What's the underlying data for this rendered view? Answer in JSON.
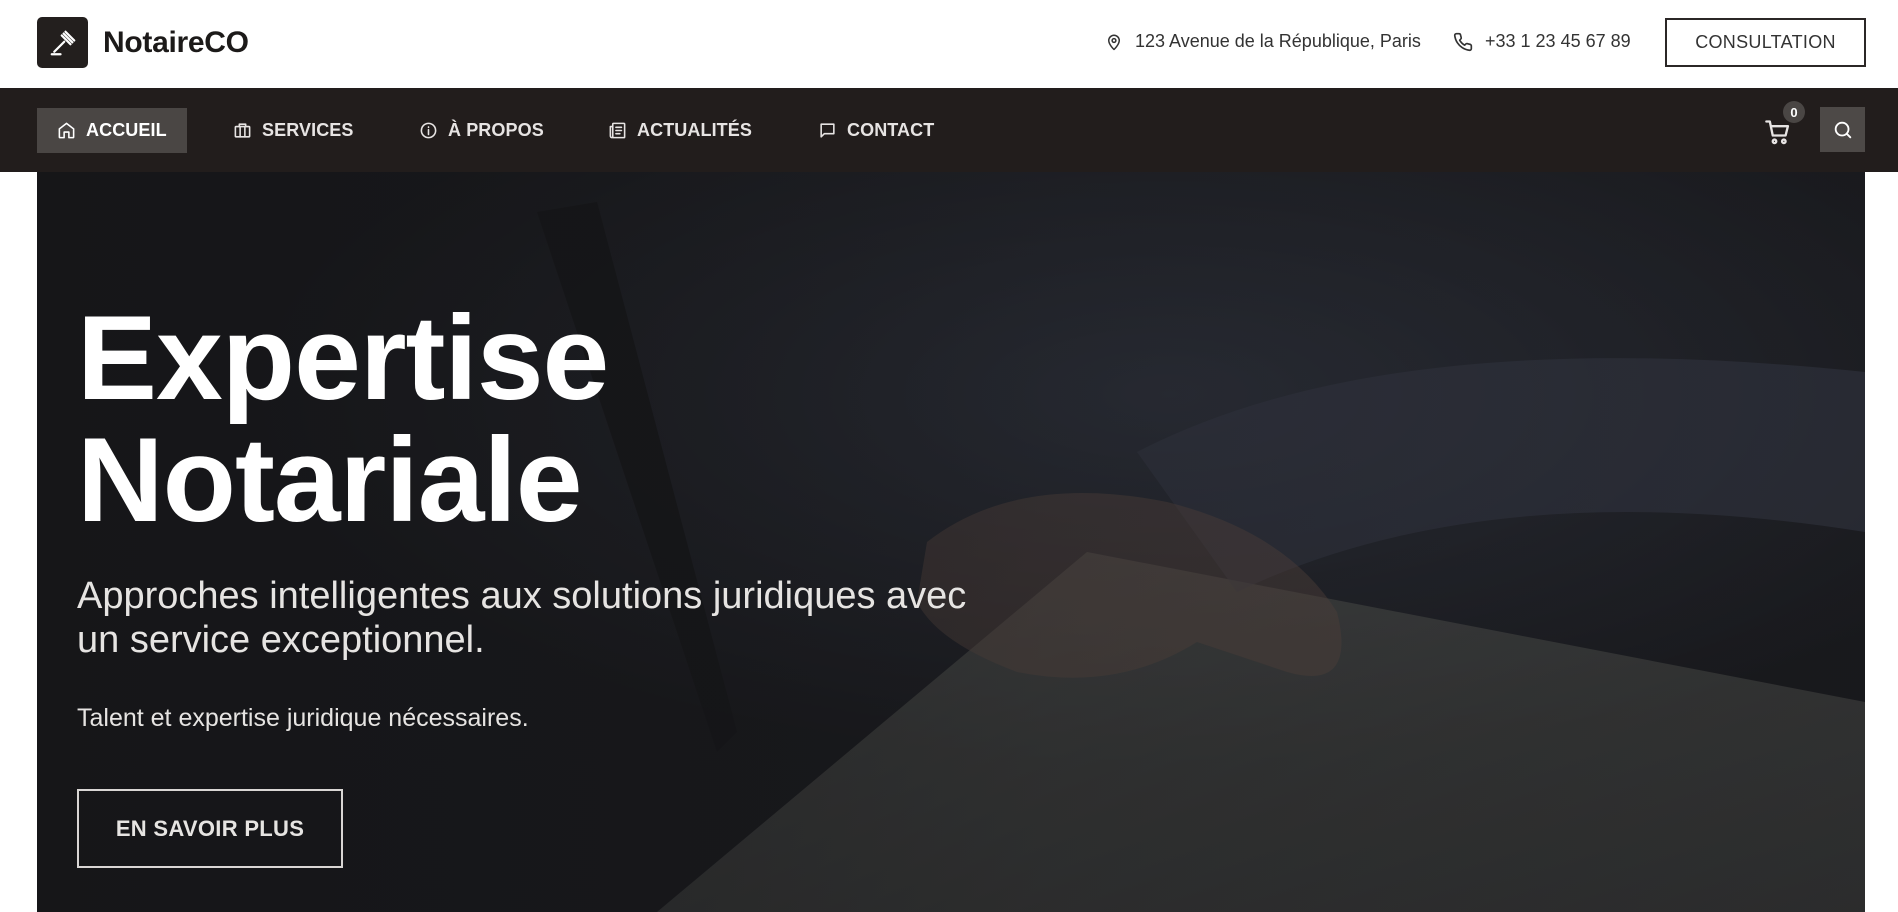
{
  "brand": {
    "name": "NotaireCO",
    "logo_icon": "gavel-icon"
  },
  "topbar": {
    "address": "123 Avenue de la République, Paris",
    "phone": "+33 1 23 45 67 89",
    "consult_label": "CONSULTATION"
  },
  "nav": {
    "items": [
      {
        "label": "ACCUEIL",
        "icon": "home-icon",
        "active": true
      },
      {
        "label": "SERVICES",
        "icon": "briefcase-icon",
        "active": false
      },
      {
        "label": "À PROPOS",
        "icon": "info-icon",
        "active": false
      },
      {
        "label": "ACTUALITÉS",
        "icon": "newspaper-icon",
        "active": false
      },
      {
        "label": "CONTACT",
        "icon": "chat-icon",
        "active": false
      }
    ],
    "cart_count": "0"
  },
  "hero": {
    "title_line1": "Expertise",
    "title_line2": "Notariale",
    "subtitle": "Approches intelligentes aux solutions juridiques avec un service exceptionnel.",
    "tagline": "Talent et expertise juridique nécessaires.",
    "cta_label": "EN SAVOIR PLUS"
  },
  "colors": {
    "nav_bg": "#221d1c",
    "active_bg": "#4a4644",
    "brand_dark": "#231f1e"
  }
}
